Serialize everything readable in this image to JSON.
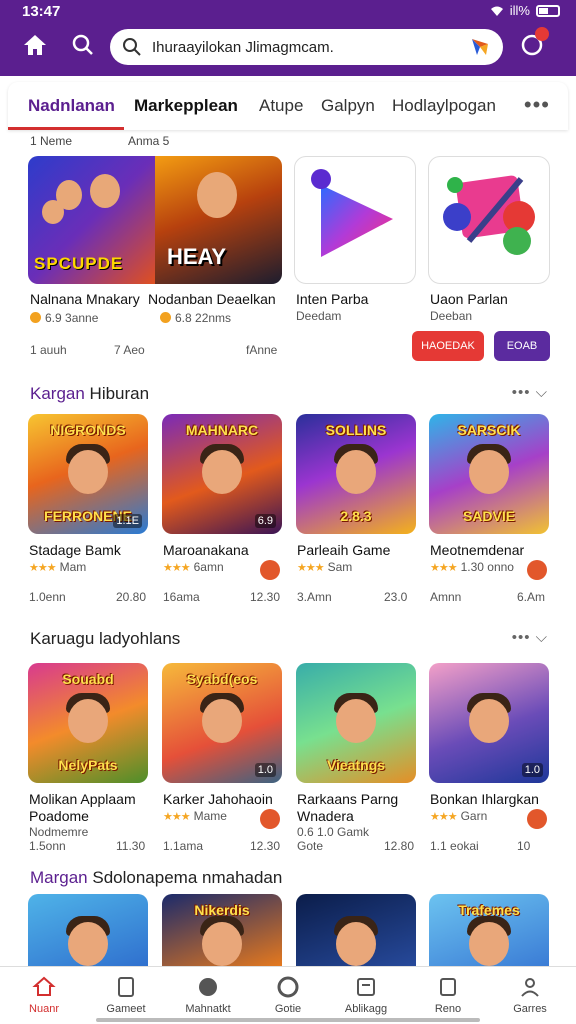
{
  "status": {
    "time": "13:47",
    "signal": "ill%"
  },
  "search": {
    "text": "Ihuraayilokan Jlimagmcam."
  },
  "tabs": [
    "Nadnlanan",
    "Markepplean",
    "Atupe",
    "Galpyn",
    "Hodlaylpogan"
  ],
  "featured": {
    "labels": [
      "1 Neme",
      "Anma 5"
    ],
    "art_a": "SPCUPDE",
    "art_b": "HEAY",
    "title_a": "Nalnana Mnakary",
    "title_b": "Nodanban Deaelkan",
    "meta_a": "6.9 3anne",
    "meta_b": "6.8 22nms",
    "foot": [
      "1 auuh",
      "7 Aeo",
      "fAnne"
    ],
    "apps": [
      {
        "title": "Inten Parba",
        "sub": "Deedam",
        "button": "HAOEDAK",
        "color": "#e53935"
      },
      {
        "title": "Uaon Parlan",
        "sub": "Deeban",
        "button": "EOAB",
        "color": "#5b2b9f"
      }
    ]
  },
  "sections": [
    {
      "title_accent": "Kargan",
      "title_rest": " Hiburan",
      "games": [
        {
          "art": "NIGRONDS",
          "art2": "FERRONENE",
          "size": "1.1E",
          "title": "Stadage Bamk",
          "meta": "Mam",
          "foot_l": "1.0enn",
          "foot_r": "20.80",
          "grad": "linear-gradient(160deg,#f7c531 0%,#e8651d 45%,#2a7bd4 100%)"
        },
        {
          "art": "MAHNARC",
          "art2": "",
          "size": "6.9",
          "title": "Maroanakana",
          "meta": "6amn",
          "foot_l": "16ama",
          "foot_r": "12.30",
          "grad": "linear-gradient(160deg,#7a2ab8 0%,#e25a1c 55%,#3a1455 100%)"
        },
        {
          "art": "SOLLINS",
          "art2": "2.8.3",
          "size": "",
          "title": "Parleaih Game",
          "meta": "Sam",
          "foot_l": "3.Amn",
          "foot_r": "23.0",
          "grad": "linear-gradient(160deg,#2a2f9a 0%,#9b35d0 45%,#f4b21b 100%)"
        },
        {
          "art": "SARSCIK",
          "art2": "SADVIE",
          "size": "",
          "title": "Meotnemdenar",
          "meta": "1.30 onno",
          "foot_l": "Amnn",
          "foot_r": "6.Am",
          "grad": "linear-gradient(160deg,#2fb4e8 0%,#a640c8 50%,#f1c232 100%)"
        }
      ]
    },
    {
      "title_accent": "",
      "title_rest": "Karuagu ladyohlans",
      "games": [
        {
          "art": "Souabd",
          "art2": "NelyPats",
          "size": "",
          "title": "Molikan Applaam",
          "title2": "Poadome",
          "sub": "Nodmemre",
          "foot_l": "1.5onn",
          "foot_r": "11.30",
          "grad": "linear-gradient(160deg,#d83a8f 0%,#f38b2b 50%,#4d8f2a 100%)"
        },
        {
          "art": "Syabd(eos",
          "art2": "",
          "size": "1.0",
          "title": "Karker Jahohaoin",
          "meta": "Mame",
          "foot_l": "1.1ama",
          "foot_r": "12.30",
          "grad": "linear-gradient(160deg,#f6b93b 0%,#e55039 60%,#3c6382 100%)"
        },
        {
          "art": "",
          "art2": "Vieatngs",
          "size": "",
          "title": "Rarkaans Parng",
          "title2": "Wnadera",
          "sub": "0.6 1.0 Gamk",
          "foot_l": "Gote",
          "foot_r": "12.80",
          "grad": "linear-gradient(160deg,#38ada9 0%,#78e08f 50%,#e58e26 100%)"
        },
        {
          "art": "",
          "art2": "",
          "size": "1.0",
          "title": "Bonkan Ihlargkan",
          "meta": "Garn",
          "foot_l": "1.1 eokai",
          "foot_r": "10",
          "grad": "linear-gradient(160deg,#f3a0c8 0%,#6a4cb8 55%,#1e3799 100%)"
        }
      ]
    }
  ],
  "section3": {
    "title_accent": "Margan",
    "title_rest": " Sdolonapema nmahadan",
    "arts": [
      "",
      "Nikerdis",
      "",
      "Trafemes"
    ],
    "grads": [
      "linear-gradient(160deg,#4fb3e8 0%,#2f6fce 100%)",
      "linear-gradient(160deg,#1b2a6b 0%,#e87a1d 100%)",
      "linear-gradient(160deg,#0b1d4a 0%,#274a9c 100%)",
      "linear-gradient(160deg,#6cc3f0 0%,#3a7bd5 100%)"
    ]
  },
  "nav": [
    {
      "label": "Nuanr",
      "icon": "home-icon",
      "active": true
    },
    {
      "label": "Gameet",
      "icon": "page-icon"
    },
    {
      "label": "Mahnatkt",
      "icon": "globe-icon"
    },
    {
      "label": "Gotie",
      "icon": "circle-icon"
    },
    {
      "label": "Ablikagg",
      "icon": "list-icon"
    },
    {
      "label": "Reno",
      "icon": "save-icon"
    },
    {
      "label": "Garres",
      "icon": "person-icon"
    }
  ],
  "colors": {
    "brand": "#5b1f8f",
    "accent": "#d32f2f",
    "star": "#f5a623"
  }
}
